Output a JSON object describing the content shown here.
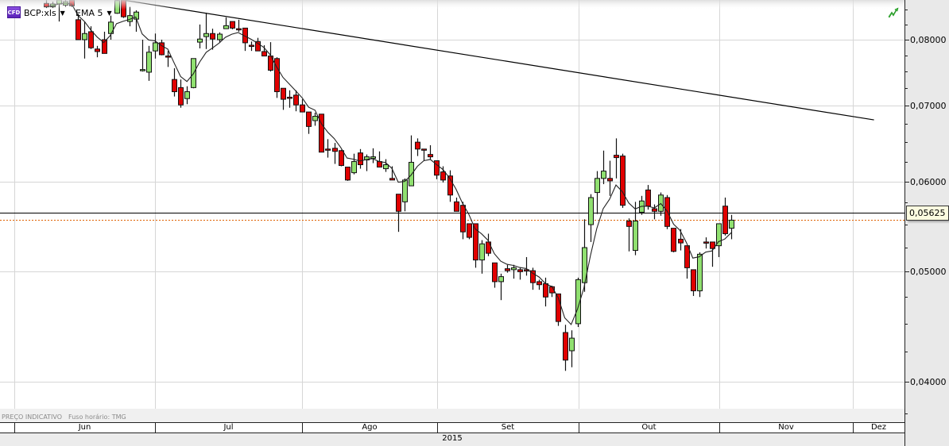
{
  "header": {
    "badge": "CFD",
    "symbol": "BCP:xls",
    "indicator": "EMA 5"
  },
  "footnote": {
    "note": "PREÇO INDICATIVO",
    "timezone": "Fuso horário: TMG"
  },
  "colors": {
    "bull": "#90e070",
    "bear": "#e00000",
    "grid": "#d6d6d6",
    "current_price_line": "#e06000"
  },
  "chart_data": {
    "type": "candlestick",
    "title": "BCP:xls",
    "y_scale": "log",
    "ylim": [
      0.037,
      0.0867
    ],
    "y_ticks": [
      "0,08000",
      "0,07000",
      "0,06000",
      "0,05000",
      "0,04000"
    ],
    "y_tick_values": [
      0.08,
      0.07,
      0.06,
      0.05,
      0.04
    ],
    "x_months": [
      "Jun",
      "Jul",
      "Ago",
      "Set",
      "Out",
      "Nov",
      "Dez"
    ],
    "x_year": "2015",
    "indicator": {
      "name": "EMA 5",
      "period": 5
    },
    "horizontal_line": {
      "value": 0.05625,
      "label": "0,05625"
    },
    "last_price": 0.0555,
    "trendline": {
      "start_index": 12.0,
      "start_price": 0.0867,
      "end_index": 129.3,
      "end_price": 0.068
    },
    "ohlc_fields": [
      "open",
      "high",
      "low",
      "close"
    ],
    "candles": [
      [
        0.0861,
        0.0867,
        0.0853,
        0.0855
      ],
      [
        0.0855,
        0.0864,
        0.0853,
        0.086
      ],
      [
        0.086,
        0.0867,
        0.083,
        0.0867
      ],
      [
        0.0858,
        0.0867,
        0.0855,
        0.0864
      ],
      [
        0.0867,
        0.0867,
        0.0855,
        0.0857
      ],
      [
        0.0833,
        0.0843,
        0.08,
        0.08
      ],
      [
        0.08,
        0.083,
        0.077,
        0.081
      ],
      [
        0.0813,
        0.0822,
        0.0785,
        0.0787
      ],
      [
        0.0785,
        0.079,
        0.0772,
        0.0781
      ],
      [
        0.08,
        0.0813,
        0.0778,
        0.0778
      ],
      [
        0.081,
        0.084,
        0.08,
        0.0829
      ],
      [
        0.0844,
        0.0867,
        0.0843,
        0.0866
      ],
      [
        0.0867,
        0.0867,
        0.0836,
        0.0838
      ],
      [
        0.083,
        0.0855,
        0.0822,
        0.084
      ],
      [
        0.0834,
        0.0849,
        0.0813,
        0.0846
      ],
      [
        0.0752,
        0.08,
        0.075,
        0.0753
      ],
      [
        0.0749,
        0.079,
        0.0736,
        0.078
      ],
      [
        0.0782,
        0.081,
        0.077,
        0.0795
      ],
      [
        0.0795,
        0.08,
        0.0775,
        0.0776
      ],
      [
        0.0774,
        0.0782,
        0.0757,
        0.0773
      ],
      [
        0.0738,
        0.0755,
        0.0713,
        0.072
      ],
      [
        0.0726,
        0.0738,
        0.0697,
        0.0701
      ],
      [
        0.071,
        0.0728,
        0.0702,
        0.072
      ],
      [
        0.0726,
        0.077,
        0.0725,
        0.077
      ],
      [
        0.0796,
        0.0825,
        0.0786,
        0.0801
      ],
      [
        0.0805,
        0.0845,
        0.0785,
        0.081
      ],
      [
        0.081,
        0.0818,
        0.0784,
        0.0801
      ],
      [
        0.08,
        0.0812,
        0.0795,
        0.0809
      ],
      [
        0.0818,
        0.0837,
        0.0818,
        0.0823
      ],
      [
        0.083,
        0.083,
        0.0817,
        0.0819
      ],
      [
        0.0818,
        0.0833,
        0.0813,
        0.0817
      ],
      [
        0.0819,
        0.0819,
        0.0782,
        0.0795
      ],
      [
        0.0791,
        0.0797,
        0.0782,
        0.079
      ],
      [
        0.0797,
        0.0803,
        0.0782,
        0.0782
      ],
      [
        0.0781,
        0.0791,
        0.0774,
        0.0774
      ],
      [
        0.0774,
        0.0796,
        0.075,
        0.0752
      ],
      [
        0.077,
        0.0772,
        0.0711,
        0.072
      ],
      [
        0.0725,
        0.0725,
        0.0694,
        0.0709
      ],
      [
        0.0712,
        0.0722,
        0.0697,
        0.0711
      ],
      [
        0.0715,
        0.0722,
        0.0692,
        0.0701
      ],
      [
        0.0701,
        0.0709,
        0.0691,
        0.0691
      ],
      [
        0.0691,
        0.0691,
        0.0661,
        0.0671
      ],
      [
        0.0679,
        0.069,
        0.0672,
        0.0685
      ],
      [
        0.0688,
        0.0688,
        0.0637,
        0.0637
      ],
      [
        0.0641,
        0.0654,
        0.063,
        0.064
      ],
      [
        0.0642,
        0.0649,
        0.0622,
        0.0638
      ],
      [
        0.0639,
        0.064,
        0.0619,
        0.062
      ],
      [
        0.0618,
        0.0618,
        0.0601,
        0.0602
      ],
      [
        0.0611,
        0.0635,
        0.0609,
        0.0625
      ],
      [
        0.0636,
        0.0641,
        0.0616,
        0.0621
      ],
      [
        0.0627,
        0.0634,
        0.0613,
        0.0631
      ],
      [
        0.0629,
        0.0642,
        0.0623,
        0.0631
      ],
      [
        0.0625,
        0.0638,
        0.0618,
        0.0618
      ],
      [
        0.0616,
        0.0628,
        0.0612,
        0.0621
      ],
      [
        0.0604,
        0.0619,
        0.0602,
        0.0602
      ],
      [
        0.0585,
        0.0585,
        0.0542,
        0.0565
      ],
      [
        0.0576,
        0.0604,
        0.0565,
        0.0602
      ],
      [
        0.0595,
        0.0659,
        0.0595,
        0.0624
      ],
      [
        0.065,
        0.0655,
        0.0632,
        0.0641
      ],
      [
        0.0641,
        0.0641,
        0.0626,
        0.064
      ],
      [
        0.0634,
        0.0646,
        0.0628,
        0.0631
      ],
      [
        0.0626,
        0.0626,
        0.0603,
        0.0608
      ],
      [
        0.0612,
        0.0619,
        0.0599,
        0.0602
      ],
      [
        0.0607,
        0.0614,
        0.0576,
        0.0584
      ],
      [
        0.0576,
        0.0581,
        0.0565,
        0.0565
      ],
      [
        0.0572,
        0.0576,
        0.0534,
        0.0542
      ],
      [
        0.0551,
        0.0551,
        0.0534,
        0.0536
      ],
      [
        0.0551,
        0.0551,
        0.0504,
        0.0512
      ],
      [
        0.0512,
        0.0533,
        0.0498,
        0.0529
      ],
      [
        0.0531,
        0.054,
        0.0516,
        0.0519
      ],
      [
        0.0509,
        0.0509,
        0.0484,
        0.049
      ],
      [
        0.049,
        0.0498,
        0.0472,
        0.0495
      ],
      [
        0.0503,
        0.0507,
        0.0499,
        0.0501
      ],
      [
        0.0502,
        0.0507,
        0.0493,
        0.0504
      ],
      [
        0.0502,
        0.0504,
        0.0492,
        0.05
      ],
      [
        0.0502,
        0.0515,
        0.0496,
        0.0501
      ],
      [
        0.0501,
        0.0504,
        0.0482,
        0.0489
      ],
      [
        0.049,
        0.0492,
        0.0482,
        0.0487
      ],
      [
        0.0488,
        0.0494,
        0.0466,
        0.0475
      ],
      [
        0.0485,
        0.0486,
        0.0475,
        0.0479
      ],
      [
        0.0478,
        0.0478,
        0.0448,
        0.0452
      ],
      [
        0.0442,
        0.0449,
        0.0409,
        0.0418
      ],
      [
        0.0426,
        0.0444,
        0.0412,
        0.0437
      ],
      [
        0.045,
        0.0494,
        0.0447,
        0.0492
      ],
      [
        0.0489,
        0.0556,
        0.048,
        0.0525
      ],
      [
        0.055,
        0.0585,
        0.0531,
        0.0581
      ],
      [
        0.0587,
        0.0613,
        0.0562,
        0.0604
      ],
      [
        0.0604,
        0.0639,
        0.0597,
        0.0613
      ],
      [
        0.0604,
        0.0626,
        0.0583,
        0.0601
      ],
      [
        0.0633,
        0.0655,
        0.0604,
        0.063
      ],
      [
        0.0632,
        0.0635,
        0.0569,
        0.0572
      ],
      [
        0.0554,
        0.0557,
        0.0521,
        0.0548
      ],
      [
        0.0522,
        0.0576,
        0.0517,
        0.0554
      ],
      [
        0.0564,
        0.0583,
        0.0561,
        0.0577
      ],
      [
        0.059,
        0.0596,
        0.0567,
        0.0571
      ],
      [
        0.0568,
        0.0573,
        0.0556,
        0.0565
      ],
      [
        0.0565,
        0.0587,
        0.056,
        0.0584
      ],
      [
        0.0581,
        0.0584,
        0.0545,
        0.0548
      ],
      [
        0.0546,
        0.0546,
        0.052,
        0.0521
      ],
      [
        0.0534,
        0.0545,
        0.0522,
        0.053
      ],
      [
        0.0527,
        0.0527,
        0.0493,
        0.0504
      ],
      [
        0.0502,
        0.0502,
        0.0476,
        0.0481
      ],
      [
        0.0481,
        0.052,
        0.0475,
        0.0518
      ],
      [
        0.0531,
        0.0536,
        0.0524,
        0.053
      ],
      [
        0.0531,
        0.0531,
        0.0505,
        0.0524
      ],
      [
        0.0527,
        0.0551,
        0.0515,
        0.0551
      ],
      [
        0.0571,
        0.0581,
        0.0538,
        0.054
      ],
      [
        0.0546,
        0.0561,
        0.0534,
        0.0555
      ]
    ]
  }
}
